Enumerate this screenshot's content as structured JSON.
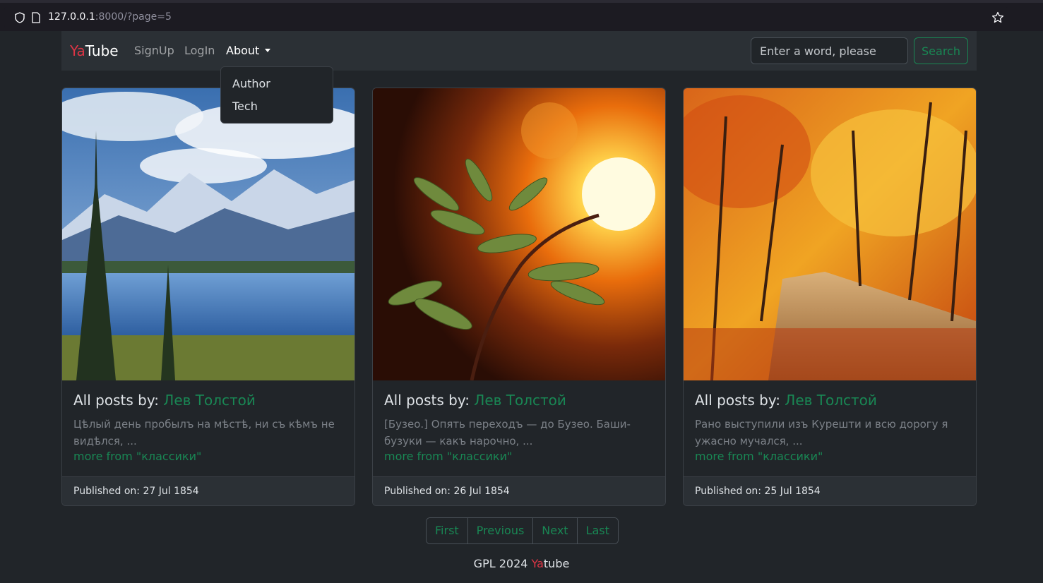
{
  "browser": {
    "url_host": "127.0.0.1",
    "url_rest": ":8000/?page=5"
  },
  "navbar": {
    "brand_prefix": "Ya",
    "brand_suffix": "Tube",
    "links": [
      "SignUp",
      "LogIn",
      "About"
    ],
    "search_placeholder": "Enter a word, please",
    "search_button": "Search"
  },
  "dropdown": {
    "items": [
      "Author",
      "Tech"
    ]
  },
  "cards": [
    {
      "title_prefix": "All posts by: ",
      "author": "Лев Толстой",
      "text": "Цѣлый день пробылъ на мѣстѣ, ни съ кѣмъ не видѣлся, ...",
      "more": "more from \"классики\"",
      "published": "Published on: 27 Jul 1854",
      "image": "mountain-lake-image"
    },
    {
      "title_prefix": "All posts by: ",
      "author": "Лев Толстой",
      "text": "[Бузео.] Опять переходъ — до Бузео. Баши-бузуки — какъ нарочно, ...",
      "more": "more from \"классики\"",
      "published": "Published on: 26 Jul 1854",
      "image": "leaf-sunset-image"
    },
    {
      "title_prefix": "All posts by: ",
      "author": "Лев Толстой",
      "text": "Рано выступили изъ Курешти и всю дорогу я ужасно мучался, ...",
      "more": "more from \"классики\"",
      "published": "Published on: 25 Jul 1854",
      "image": "autumn-forest-image"
    }
  ],
  "pagination": [
    "First",
    "Previous",
    "Next",
    "Last"
  ],
  "footer": {
    "prefix": "GPL 2024 ",
    "brand_red": "Ya",
    "brand_rest": "tube"
  },
  "colors": {
    "accent": "#198754",
    "brand_red": "#dc3545",
    "background": "#212529"
  }
}
